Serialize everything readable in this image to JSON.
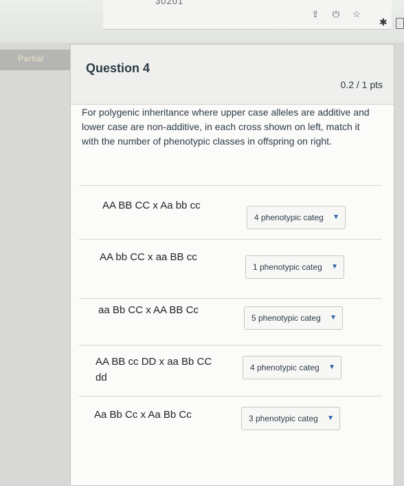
{
  "browser": {
    "title_fragment": "30201",
    "icons": [
      "share-icon",
      "lock-icon",
      "star-icon"
    ]
  },
  "badge": {
    "label": "Partial"
  },
  "question": {
    "title": "Question 4",
    "points": "0.2 / 1 pts",
    "text": "For polygenic inheritance where upper case alleles are additive and lower case are non-additive, in each cross shown on left, match it with the number of phenotypic classes in offspring on right."
  },
  "pairs": [
    {
      "cross": "AA BB CC x Aa bb cc",
      "answer": "4 phenotypic categ"
    },
    {
      "cross": "AA bb CC x aa BB cc",
      "answer": "1 phenotypic categ"
    },
    {
      "cross": "aa Bb CC x AA BB Cc",
      "answer": "5 phenotypic categ"
    },
    {
      "cross": "AA BB cc DD x aa Bb CC dd",
      "answer": "4 phenotypic categ"
    },
    {
      "cross": "Aa Bb Cc x Aa Bb Cc",
      "answer": "3 phenotypic categ"
    }
  ]
}
